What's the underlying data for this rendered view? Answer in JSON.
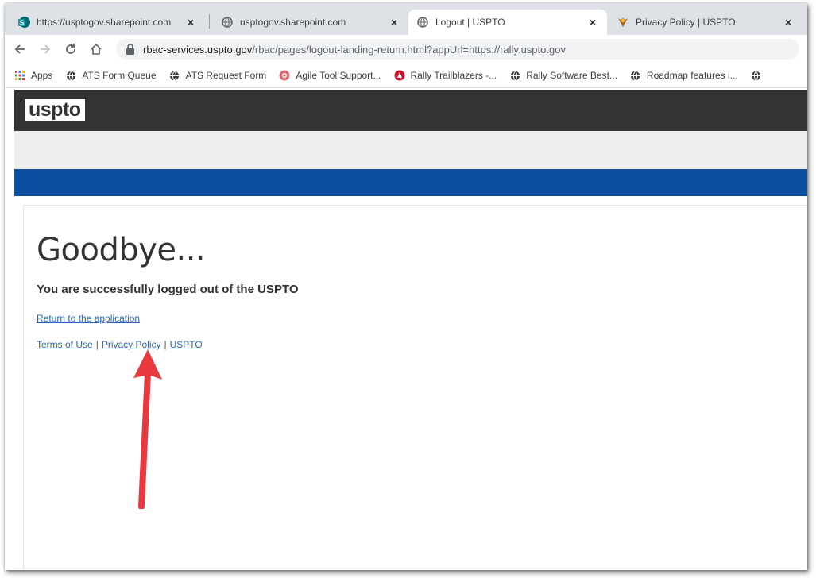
{
  "browser": {
    "tabs": [
      {
        "title": "https://usptogov.sharepoint.com",
        "icon": "sharepoint-icon",
        "active": false
      },
      {
        "title": "usptogov.sharepoint.com",
        "icon": "globe-icon",
        "active": false
      },
      {
        "title": "Logout | USPTO",
        "icon": "globe-icon",
        "active": true
      },
      {
        "title": "Privacy Policy | USPTO",
        "icon": "uspto-eagle-icon",
        "active": false
      }
    ],
    "tab_close": "×",
    "url_domain": "rbac-services.uspto.gov",
    "url_path": "/rbac/pages/logout-landing-return.html?appUrl=https://rally.uspto.gov",
    "bookmarks": [
      {
        "label": "Apps",
        "icon": "apps-grid-icon"
      },
      {
        "label": "ATS Form Queue",
        "icon": "globe-icon"
      },
      {
        "label": "ATS Request Form",
        "icon": "globe-icon"
      },
      {
        "label": "Agile Tool Support...",
        "icon": "agile-icon"
      },
      {
        "label": "Rally Trailblazers -...",
        "icon": "rally-icon"
      },
      {
        "label": "Rally Software Best...",
        "icon": "globe-icon"
      },
      {
        "label": "Roadmap features i...",
        "icon": "globe-icon"
      }
    ]
  },
  "site": {
    "logo": "uspto",
    "heading": "Goodbye...",
    "message": "You are successfully logged out of the USPTO",
    "return_link": "Return to the application",
    "footer": {
      "terms": "Terms of Use",
      "privacy": "Privacy Policy",
      "uspto": "USPTO",
      "separator": "|"
    }
  },
  "colors": {
    "header_dark": "#333333",
    "nav_blue": "#0b4fa2",
    "link_blue": "#2a64b8",
    "arrow_red": "#e8393e"
  }
}
